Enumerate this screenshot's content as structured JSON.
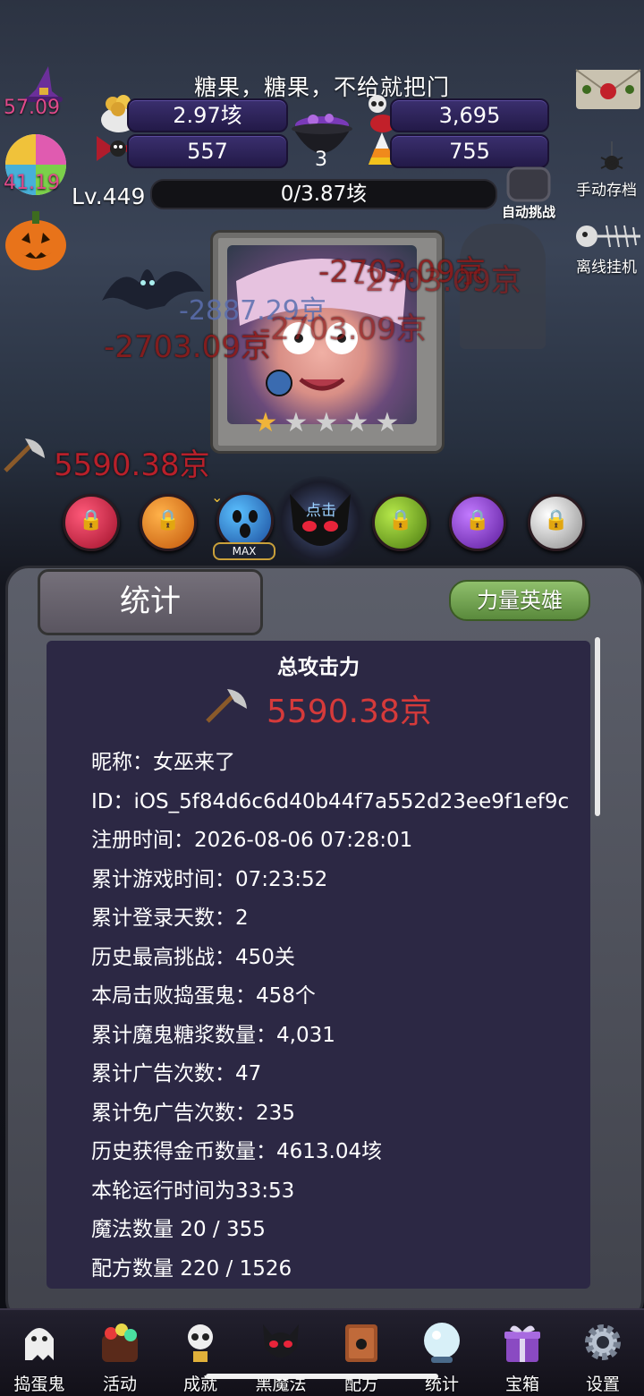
{
  "hud": {
    "title": "糖果，糖果，不给就把门",
    "gold": "2.97垓",
    "skull_potion": "3,695",
    "bowtie_candy": "557",
    "candy_corn": "755",
    "cauldron_count": "3",
    "witch_hat_timer": "57.09",
    "lollipop_timer": "41.19",
    "level": "Lv.449",
    "xp": "0/3.87垓",
    "auto_challenge": "自动挑战",
    "manual_save": "手动存档",
    "offline_idle": "离线挂机"
  },
  "battle": {
    "damage_numbers": [
      "-2703.09京",
      "-2887.29京",
      "-2703.09京",
      "-2703.09京",
      "-2703.09京"
    ],
    "attack_power": "5590.38京",
    "click_label": "点击",
    "stars_total": 5,
    "stars_filled": 1,
    "max_badge": "MAX"
  },
  "panel": {
    "tab_label": "统计",
    "hero_button": "力量英雄",
    "heading": "总攻击力",
    "total_power": "5590.38京",
    "rows": [
      "昵称：女巫来了",
      "ID：iOS_5f84d6c6d40b44f7a552d23ee9f1ef9c",
      "注册时间：2026-08-06 07:28:01",
      "累计游戏时间：07:23:52",
      "累计登录天数：2",
      "历史最高挑战：450关",
      "本局击败捣蛋鬼：458个",
      "累计魔鬼糖浆数量：4,031",
      "累计广告次数：47",
      "累计免广告次数：235",
      "历史获得金币数量：4613.04垓",
      "本轮运行时间为33:53",
      "魔法数量 20 / 355",
      "配方数量 220 / 1526"
    ]
  },
  "nav": {
    "items": [
      "捣蛋鬼",
      "活动",
      "成就",
      "黑魔法",
      "配方",
      "统计",
      "宝箱",
      "设置"
    ]
  },
  "colors": {
    "damage_red": "#d63a3a",
    "panel_bg": "#2c2844",
    "hero_green": "#6f9f4e"
  }
}
